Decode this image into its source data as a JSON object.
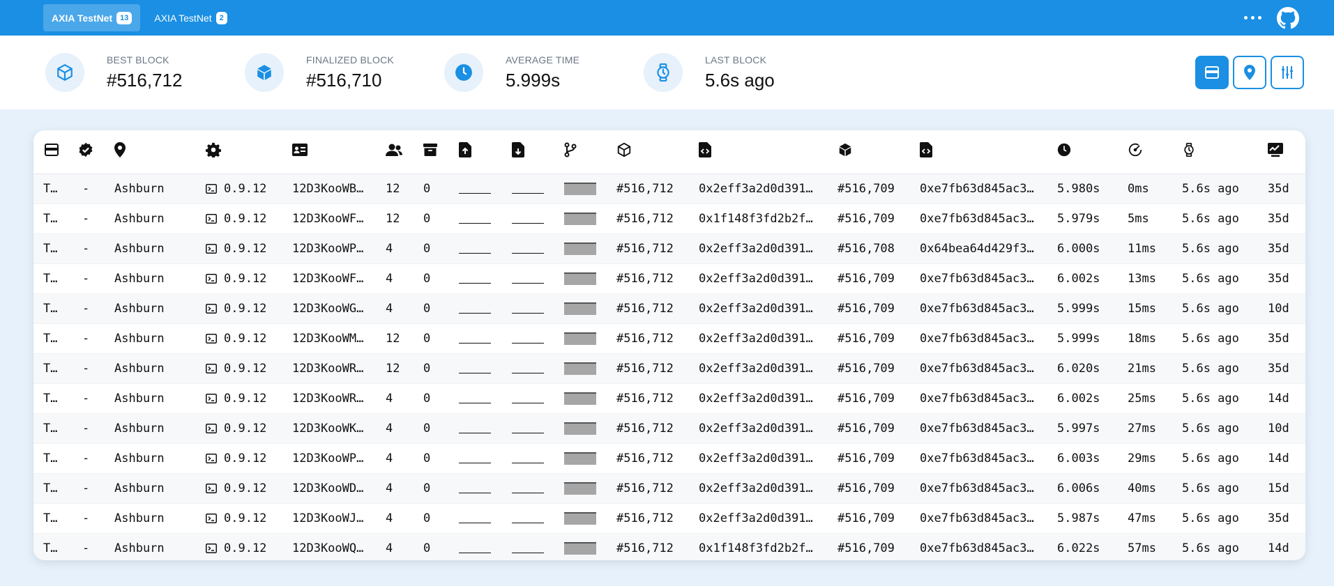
{
  "tabs": [
    {
      "label": "AXIA TestNet",
      "count": "13"
    },
    {
      "label": "AXIA TestNet",
      "count": "2"
    }
  ],
  "stats": {
    "best_block": {
      "label": "BEST BLOCK",
      "value": "#516,712"
    },
    "finalized_block": {
      "label": "FINALIZED BLOCK",
      "value": "#516,710"
    },
    "average_time": {
      "label": "AVERAGE TIME",
      "value": "5.999s"
    },
    "last_block": {
      "label": "LAST BLOCK",
      "value": "5.6s ago"
    }
  },
  "columns": [
    "card-icon",
    "validator-icon",
    "location-icon",
    "settings-icon",
    "id-card-icon",
    "peers-icon",
    "archive-icon",
    "upload-icon",
    "download-icon",
    "fork-icon",
    "cube-outline-icon",
    "file-code-icon",
    "cube-solid-icon",
    "file-code-icon",
    "clock-icon",
    "gauge-icon",
    "stopwatch-icon",
    "uptime-icon"
  ],
  "rows": [
    {
      "name": "T…",
      "validator": "-",
      "location": "Ashburn",
      "version": "0.9.12",
      "network_id": "12D3KooWB…",
      "peers": "12",
      "txs": "0",
      "block": "#516,712",
      "block_hash": "0x2eff3a2d0d391…",
      "finalized": "#516,709",
      "finalized_hash": "0xe7fb63d845ac3…",
      "block_time": "5.980s",
      "propagation": "0ms",
      "last_block": "5.6s ago",
      "uptime": "35d"
    },
    {
      "name": "T…",
      "validator": "-",
      "location": "Ashburn",
      "version": "0.9.12",
      "network_id": "12D3KooWF…",
      "peers": "12",
      "txs": "0",
      "block": "#516,712",
      "block_hash": "0x1f148f3fd2b2f…",
      "finalized": "#516,709",
      "finalized_hash": "0xe7fb63d845ac3…",
      "block_time": "5.979s",
      "propagation": "5ms",
      "last_block": "5.6s ago",
      "uptime": "35d"
    },
    {
      "name": "T…",
      "validator": "-",
      "location": "Ashburn",
      "version": "0.9.12",
      "network_id": "12D3KooWP…",
      "peers": "4",
      "txs": "0",
      "block": "#516,712",
      "block_hash": "0x2eff3a2d0d391…",
      "finalized": "#516,708",
      "finalized_hash": "0x64bea64d429f3…",
      "block_time": "6.000s",
      "propagation": "11ms",
      "last_block": "5.6s ago",
      "uptime": "35d"
    },
    {
      "name": "T…",
      "validator": "-",
      "location": "Ashburn",
      "version": "0.9.12",
      "network_id": "12D3KooWF…",
      "peers": "4",
      "txs": "0",
      "block": "#516,712",
      "block_hash": "0x2eff3a2d0d391…",
      "finalized": "#516,709",
      "finalized_hash": "0xe7fb63d845ac3…",
      "block_time": "6.002s",
      "propagation": "13ms",
      "last_block": "5.6s ago",
      "uptime": "35d"
    },
    {
      "name": "T…",
      "validator": "-",
      "location": "Ashburn",
      "version": "0.9.12",
      "network_id": "12D3KooWG…",
      "peers": "4",
      "txs": "0",
      "block": "#516,712",
      "block_hash": "0x2eff3a2d0d391…",
      "finalized": "#516,709",
      "finalized_hash": "0xe7fb63d845ac3…",
      "block_time": "5.999s",
      "propagation": "15ms",
      "last_block": "5.6s ago",
      "uptime": "10d"
    },
    {
      "name": "T…",
      "validator": "-",
      "location": "Ashburn",
      "version": "0.9.12",
      "network_id": "12D3KooWM…",
      "peers": "12",
      "txs": "0",
      "block": "#516,712",
      "block_hash": "0x2eff3a2d0d391…",
      "finalized": "#516,709",
      "finalized_hash": "0xe7fb63d845ac3…",
      "block_time": "5.999s",
      "propagation": "18ms",
      "last_block": "5.6s ago",
      "uptime": "35d"
    },
    {
      "name": "T…",
      "validator": "-",
      "location": "Ashburn",
      "version": "0.9.12",
      "network_id": "12D3KooWR…",
      "peers": "12",
      "txs": "0",
      "block": "#516,712",
      "block_hash": "0x2eff3a2d0d391…",
      "finalized": "#516,709",
      "finalized_hash": "0xe7fb63d845ac3…",
      "block_time": "6.020s",
      "propagation": "21ms",
      "last_block": "5.6s ago",
      "uptime": "35d"
    },
    {
      "name": "T…",
      "validator": "-",
      "location": "Ashburn",
      "version": "0.9.12",
      "network_id": "12D3KooWR…",
      "peers": "4",
      "txs": "0",
      "block": "#516,712",
      "block_hash": "0x2eff3a2d0d391…",
      "finalized": "#516,709",
      "finalized_hash": "0xe7fb63d845ac3…",
      "block_time": "6.002s",
      "propagation": "25ms",
      "last_block": "5.6s ago",
      "uptime": "14d"
    },
    {
      "name": "T…",
      "validator": "-",
      "location": "Ashburn",
      "version": "0.9.12",
      "network_id": "12D3KooWK…",
      "peers": "4",
      "txs": "0",
      "block": "#516,712",
      "block_hash": "0x2eff3a2d0d391…",
      "finalized": "#516,709",
      "finalized_hash": "0xe7fb63d845ac3…",
      "block_time": "5.997s",
      "propagation": "27ms",
      "last_block": "5.6s ago",
      "uptime": "10d"
    },
    {
      "name": "T…",
      "validator": "-",
      "location": "Ashburn",
      "version": "0.9.12",
      "network_id": "12D3KooWP…",
      "peers": "4",
      "txs": "0",
      "block": "#516,712",
      "block_hash": "0x2eff3a2d0d391…",
      "finalized": "#516,709",
      "finalized_hash": "0xe7fb63d845ac3…",
      "block_time": "6.003s",
      "propagation": "29ms",
      "last_block": "5.6s ago",
      "uptime": "14d"
    },
    {
      "name": "T…",
      "validator": "-",
      "location": "Ashburn",
      "version": "0.9.12",
      "network_id": "12D3KooWD…",
      "peers": "4",
      "txs": "0",
      "block": "#516,712",
      "block_hash": "0x2eff3a2d0d391…",
      "finalized": "#516,709",
      "finalized_hash": "0xe7fb63d845ac3…",
      "block_time": "6.006s",
      "propagation": "40ms",
      "last_block": "5.6s ago",
      "uptime": "15d"
    },
    {
      "name": "T…",
      "validator": "-",
      "location": "Ashburn",
      "version": "0.9.12",
      "network_id": "12D3KooWJ…",
      "peers": "4",
      "txs": "0",
      "block": "#516,712",
      "block_hash": "0x2eff3a2d0d391…",
      "finalized": "#516,709",
      "finalized_hash": "0xe7fb63d845ac3…",
      "block_time": "5.987s",
      "propagation": "47ms",
      "last_block": "5.6s ago",
      "uptime": "35d"
    },
    {
      "name": "T…",
      "validator": "-",
      "location": "Ashburn",
      "version": "0.9.12",
      "network_id": "12D3KooWQ…",
      "peers": "4",
      "txs": "0",
      "block": "#516,712",
      "block_hash": "0x1f148f3fd2b2f…",
      "finalized": "#516,709",
      "finalized_hash": "0xe7fb63d845ac3…",
      "block_time": "6.022s",
      "propagation": "57ms",
      "last_block": "5.6s ago",
      "uptime": "14d"
    }
  ],
  "colors": {
    "accent": "#1a8fe3",
    "page_bg": "#e6f1fb",
    "bar_fill": "#a6a6a6"
  }
}
